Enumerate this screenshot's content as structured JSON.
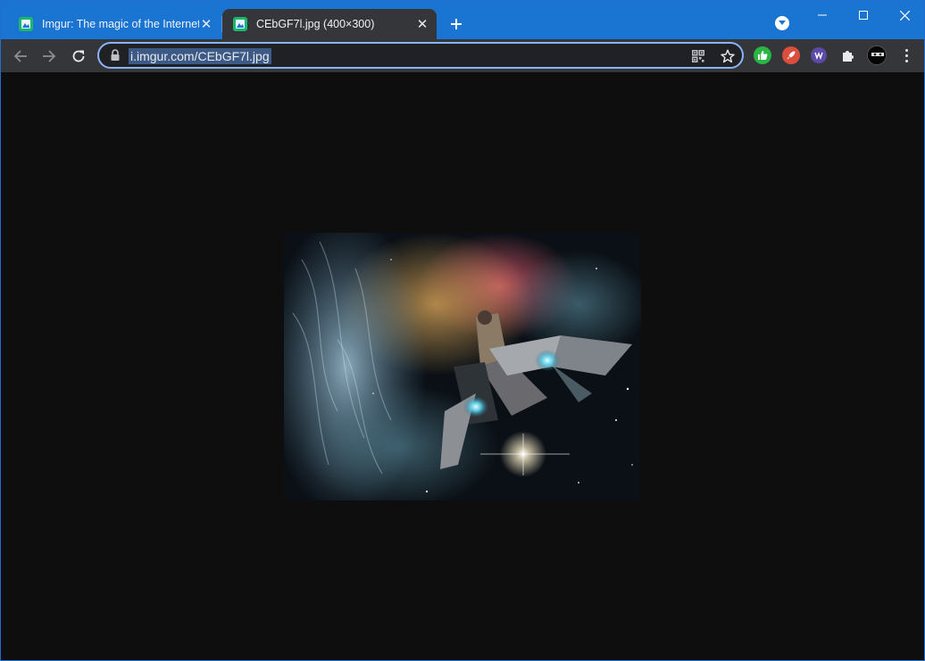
{
  "tabs": [
    {
      "title": "Imgur: The magic of the Internet",
      "active": false
    },
    {
      "title": "CEbGF7l.jpg (400×300)",
      "active": true
    }
  ],
  "address_bar": {
    "url": "i.imgur.com/CEbGF7l.jpg"
  },
  "icons": {
    "favicon": "imgur-favicon-icon",
    "back": "arrow-left-icon",
    "forward": "arrow-right-icon",
    "reload": "reload-icon",
    "lock": "lock-icon",
    "qr": "qr-code-icon",
    "bookmark": "star-icon",
    "extensions": "puzzle-icon",
    "menu": "kebab-menu-icon"
  },
  "colors": {
    "tabstrip": "#1a74d2",
    "toolbar": "#35363a",
    "content_bg": "#0e0e0e",
    "omnibox_focus": "#8ab4f8"
  }
}
